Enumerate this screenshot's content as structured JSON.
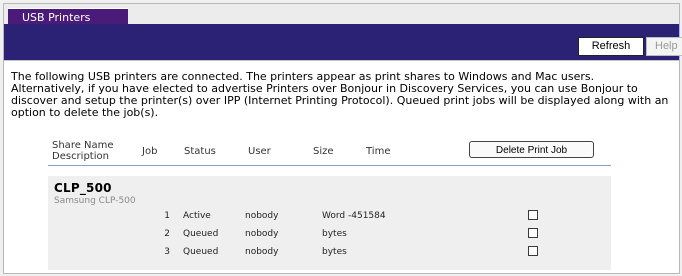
{
  "tab": {
    "label": "USB Printers"
  },
  "toolbar": {
    "refresh_label": "Refresh",
    "help_label": "Help"
  },
  "intro": "The following USB printers are connected. The printers appear as print shares to Windows and Mac users. Alternatively, if you have elected to advertise Printers over Bonjour in Discovery Services, you can use Bonjour to discover and setup the printer(s) over IPP (Internet Printing Protocol). Queued print jobs will be displayed along with an option to delete the job(s).",
  "table": {
    "headers": {
      "share": "Share Name",
      "description": "Description",
      "job": "Job",
      "status": "Status",
      "user": "User",
      "size": "Size",
      "time": "Time"
    },
    "delete_label": "Delete Print Job",
    "printer": {
      "name": "CLP_500",
      "description": "Samsung CLP-500"
    },
    "rows": [
      {
        "job": "1",
        "status": "Active",
        "user": "nobody",
        "size": "Word -451584",
        "checked": false
      },
      {
        "job": "2",
        "status": "Queued",
        "user": "nobody",
        "size": "bytes",
        "checked": false
      },
      {
        "job": "3",
        "status": "Queued",
        "user": "nobody",
        "size": "bytes",
        "checked": false
      }
    ]
  }
}
